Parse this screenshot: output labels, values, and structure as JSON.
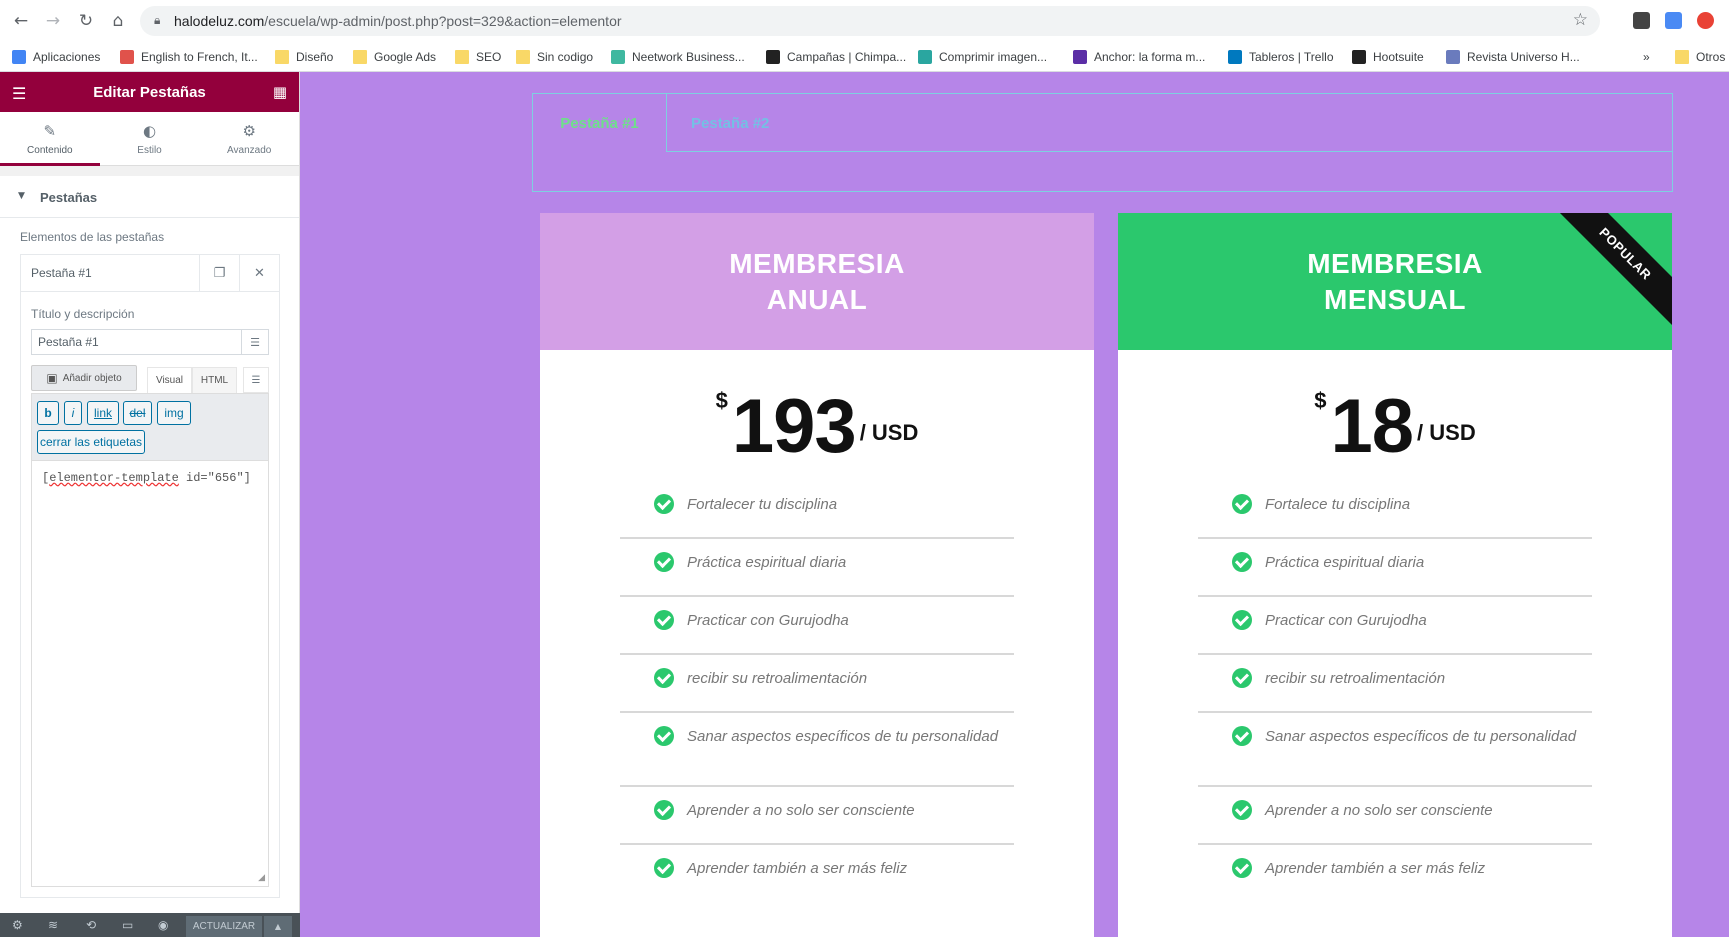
{
  "browser": {
    "url_host": "halodeluz.com",
    "url_path": "/escuela/wp-admin/post.php?post=329&action=elementor",
    "bookmarks": [
      {
        "label": "Aplicaciones",
        "icon": "apps-grid-icon"
      },
      {
        "label": "English to French, It...",
        "icon": "wr-icon"
      },
      {
        "label": "Diseño",
        "icon": "folder-icon"
      },
      {
        "label": "Google Ads",
        "icon": "folder-icon"
      },
      {
        "label": "SEO",
        "icon": "folder-icon"
      },
      {
        "label": "Sin codigo",
        "icon": "folder-icon"
      },
      {
        "label": "Neetwork Business...",
        "icon": "neetwork-icon"
      },
      {
        "label": "Campañas | Chimpa...",
        "icon": "mailchimp-icon"
      },
      {
        "label": "Comprimir imagen...",
        "icon": "compress-icon"
      },
      {
        "label": "Anchor: la forma m...",
        "icon": "anchor-icon"
      },
      {
        "label": "Tableros | Trello",
        "icon": "trello-icon"
      },
      {
        "label": "Hootsuite",
        "icon": "hootsuite-icon"
      },
      {
        "label": "Revista Universo H...",
        "icon": "document-icon"
      },
      {
        "label": "»",
        "icon": ""
      },
      {
        "label": "Otros",
        "icon": "folder-icon"
      }
    ]
  },
  "panel": {
    "header_title": "Editar Pestañas",
    "tabs": [
      {
        "label": "Contenido",
        "icon": "pencil-icon"
      },
      {
        "label": "Estilo",
        "icon": "contrast-icon"
      },
      {
        "label": "Avanzado",
        "icon": "gear-icon"
      }
    ],
    "section_title": "Pestañas",
    "items_label": "Elementos de las pestañas",
    "repeater_item_title": "Pestaña #1",
    "field_label": "Título y descripción",
    "title_value": "Pestaña #1",
    "add_media_label": "Añadir objeto",
    "editor_tab_visual": "Visual",
    "editor_tab_html": "HTML",
    "quicktags": [
      "b",
      "i",
      "link",
      "del",
      "img",
      "cerrar las etiquetas"
    ],
    "editor_content_prefix": "[",
    "editor_content_squiggle": "elementor-template",
    "editor_content_suffix": " id=\"656\"]",
    "footer_update": "ACTUALIZAR"
  },
  "preview": {
    "colors": {
      "background": "#b685e8",
      "tab_border": "#7ecfe0",
      "annual_header": "#d39fe6",
      "monthly_header": "#2bc86d",
      "check": "#2bc86d"
    },
    "tabs": [
      "Pestaña #1",
      "Pestaña #2"
    ],
    "cards": [
      {
        "title_line1": "MEMBRESIA",
        "title_line2": "ANUAL",
        "currency": "$",
        "amount": "193",
        "period": "/ USD",
        "features": [
          "Fortalecer tu disciplina",
          "Práctica espiritual diaria",
          "Practicar con Gurujodha",
          "recibir su retroalimentación",
          "Sanar aspectos específicos de tu personalidad",
          "Aprender a no solo ser consciente",
          "Aprender también a ser más feliz"
        ]
      },
      {
        "title_line1": "MEMBRESIA",
        "title_line2": "MENSUAL",
        "currency": "$",
        "amount": "18",
        "period": "/ USD",
        "ribbon": "POPULAR",
        "features": [
          "Fortalece tu disciplina",
          "Práctica espiritual diaria",
          "Practicar con Gurujodha",
          "recibir su retroalimentación",
          "Sanar aspectos específicos de tu personalidad",
          "Aprender a no solo ser consciente",
          "Aprender también a ser más feliz"
        ]
      }
    ]
  }
}
